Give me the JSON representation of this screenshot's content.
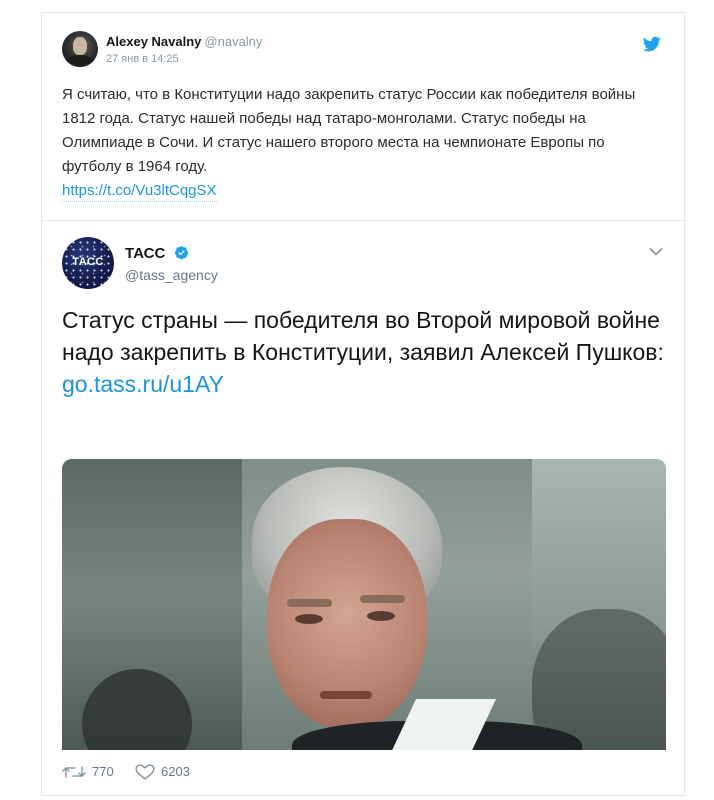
{
  "tweet": {
    "display_name": "Alexey Navalny",
    "handle": "@navalny",
    "timestamp": "27 янв в 14:25",
    "text": "Я считаю, что в Конституции надо закрепить статус России как победителя войны 1812 года. Статус нашей победы над татаро-монголами. Статус победы на Олимпиаде в Сочи. И статус нашего второго места на чемпионате Европы по футболу в 1964 году.",
    "link": "https://t.co/Vu3ltCqgSX",
    "retweets": "770",
    "likes": "6203"
  },
  "quoted": {
    "display_name": "ТАСС",
    "handle": "@tass_agency",
    "logo_text": "ТАСС",
    "text": "Статус страны — победителя во Второй мировой войне надо закрепить в Конституции, заявил Алексей Пушков:",
    "link": "go.tass.ru/u1AY"
  },
  "colors": {
    "link": "#1b95e0",
    "twitter_blue": "#1da1f2",
    "muted": "#8899a6"
  },
  "icons": [
    "twitter-bird-icon",
    "verified-badge-icon",
    "chevron-down-icon",
    "retweet-icon",
    "heart-icon"
  ]
}
